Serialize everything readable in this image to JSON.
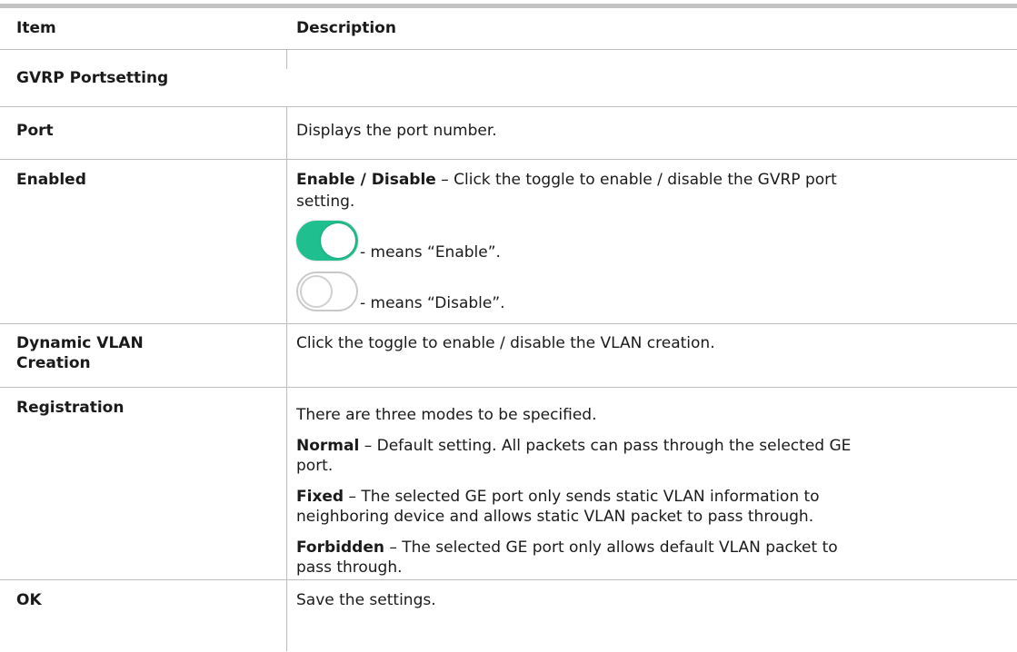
{
  "table": {
    "headers": {
      "item": "Item",
      "description": "Description"
    },
    "section_title": "GVRP Portsetting",
    "rows": [
      {
        "item": "Port",
        "description": "Displays the port number."
      },
      {
        "item": "Enabled",
        "desc_bold": "Enable / Disable",
        "desc_rest": " – Click the toggle to enable / disable the GVRP port",
        "desc_line2": "setting.",
        "toggle_on_text": "- means “Enable”.",
        "toggle_off_text": "- means “Disable”."
      },
      {
        "item_line1": "Dynamic VLAN",
        "item_line2": "Creation",
        "description": "Click the toggle to enable / disable the VLAN creation."
      },
      {
        "item": "Registration",
        "intro": "There are three modes to be specified.",
        "normal_label": "Normal",
        "normal_text_1": " – Default setting. All packets can pass through the selected GE",
        "normal_text_2": "port.",
        "fixed_label": "Fixed",
        "fixed_text_1": " – The selected GE port only sends static VLAN information to",
        "fixed_text_2": "neighboring device and allows static VLAN packet to pass through.",
        "forbidden_label": "Forbidden",
        "forbidden_text_1": " – The selected GE port only allows default VLAN packet to",
        "forbidden_text_2": "pass through."
      },
      {
        "item": "OK",
        "description": "Save the settings."
      }
    ]
  },
  "toggle_icons": {
    "on": "toggle-on-icon",
    "off": "toggle-off-icon",
    "on_color": "#1fbf8f",
    "off_color": "#c9c9c9"
  }
}
